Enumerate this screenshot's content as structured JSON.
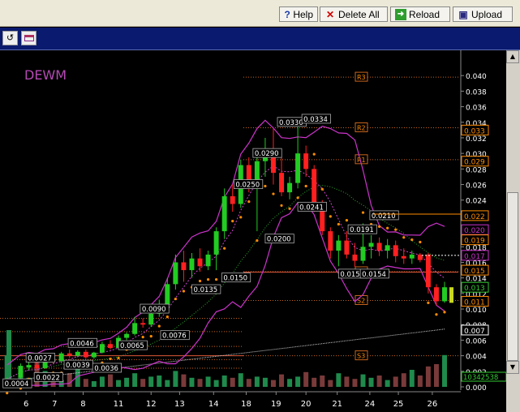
{
  "toolbar": {
    "help_label": "Help",
    "delete_all_label": "Delete All",
    "reload_label": "Reload",
    "upload_label": "Upload"
  },
  "chart_data": {
    "type": "candlestick",
    "title": "DEWM",
    "x_tick_labels": [
      "6",
      "7",
      "8",
      "11",
      "12",
      "13",
      "14",
      "18",
      "19",
      "20",
      "21",
      "24",
      "25",
      "26"
    ],
    "y_axis": {
      "range": [
        0.0,
        0.042
      ],
      "tick_labels": [
        "0.040",
        "0.038",
        "0.036",
        "0.034",
        "0.032",
        "0.030",
        "0.028",
        "0.026",
        "0.024",
        "0.022",
        "0.020",
        "0.018",
        "0.016",
        "0.014",
        "0.012",
        "0.010",
        "0.008",
        "0.006",
        "0.004",
        "0.002",
        "0.000"
      ],
      "highlighted_labels": [
        {
          "text": "0.033",
          "value": 0.033,
          "color": "#ff8c00"
        },
        {
          "text": "0.029",
          "value": 0.029,
          "color": "#ff8c00"
        },
        {
          "text": "0.022",
          "value": 0.022,
          "color": "#ff8c00"
        },
        {
          "text": "0.020",
          "value": 0.0202,
          "color": "#cc33cc"
        },
        {
          "text": "0.019",
          "value": 0.0189,
          "color": "#ff8c00"
        },
        {
          "text": "0.017",
          "value": 0.0169,
          "color": "#cc33cc"
        },
        {
          "text": "0.015",
          "value": 0.015,
          "color": "#ff8c00"
        },
        {
          "text": "0.013",
          "value": 0.0128,
          "color": "#33cc33"
        },
        {
          "text": "0.011",
          "value": 0.011,
          "color": "#ff8c00"
        },
        {
          "text": "0.007",
          "value": 0.0073,
          "color": "#ffffff"
        }
      ],
      "volume_label": "10342538"
    },
    "pivot_levels": [
      {
        "name": "R3",
        "value": 0.0398
      },
      {
        "name": "R2",
        "value": 0.0333
      },
      {
        "name": "R1",
        "value": 0.0292
      },
      {
        "name": "S1",
        "value": 0.0148
      },
      {
        "name": "S2",
        "value": 0.0111
      },
      {
        "name": "S3",
        "value": 0.004
      }
    ],
    "annotations": [
      {
        "text": "0.0004",
        "day": 0.05,
        "value": 0.0004
      },
      {
        "text": "0.0022",
        "day": 1.2,
        "value": 0.0012
      },
      {
        "text": "0.0027",
        "day": 0.9,
        "value": 0.0037
      },
      {
        "text": "0.0039",
        "day": 2.3,
        "value": 0.0028
      },
      {
        "text": "0.0046",
        "day": 2.45,
        "value": 0.0056
      },
      {
        "text": "0.0036",
        "day": 3.35,
        "value": 0.0024
      },
      {
        "text": "0.0065",
        "day": 4.3,
        "value": 0.0053
      },
      {
        "text": "0.0090",
        "day": 5.1,
        "value": 0.01
      },
      {
        "text": "0.0076",
        "day": 5.85,
        "value": 0.0066
      },
      {
        "text": "0.0135",
        "day": 7.0,
        "value": 0.0125
      },
      {
        "text": "0.0150",
        "day": 8.1,
        "value": 0.014
      },
      {
        "text": "0.0250",
        "day": 8.55,
        "value": 0.026
      },
      {
        "text": "0.0200",
        "day": 9.7,
        "value": 0.019
      },
      {
        "text": "0.0290",
        "day": 9.25,
        "value": 0.03
      },
      {
        "text": "0.0330",
        "day": 10.15,
        "value": 0.034
      },
      {
        "text": "0.0334",
        "day": 11.05,
        "value": 0.0344
      },
      {
        "text": "0.0241",
        "day": 10.9,
        "value": 0.0231
      },
      {
        "text": "0.0191",
        "day": 12.75,
        "value": 0.0202
      },
      {
        "text": "0.0155",
        "day": 12.4,
        "value": 0.0145
      },
      {
        "text": "0.0154",
        "day": 13.2,
        "value": 0.0145
      },
      {
        "text": "0.0210",
        "day": 13.55,
        "value": 0.022
      }
    ],
    "candles": [
      {
        "day": 0.2,
        "o": 0.0008,
        "h": 0.0012,
        "l": 0.0004,
        "c": 0.001
      },
      {
        "day": 0.7,
        "o": 0.0012,
        "h": 0.003,
        "l": 0.001,
        "c": 0.0027
      },
      {
        "day": 1.0,
        "o": 0.0025,
        "h": 0.0032,
        "l": 0.0022,
        "c": 0.0028
      },
      {
        "day": 1.3,
        "o": 0.0028,
        "h": 0.0034,
        "l": 0.0022,
        "c": 0.0024
      },
      {
        "day": 1.6,
        "o": 0.0024,
        "h": 0.0038,
        "l": 0.0023,
        "c": 0.0036
      },
      {
        "day": 1.9,
        "o": 0.0036,
        "h": 0.0042,
        "l": 0.003,
        "c": 0.0033
      },
      {
        "day": 2.2,
        "o": 0.0033,
        "h": 0.0045,
        "l": 0.003,
        "c": 0.0043
      },
      {
        "day": 2.5,
        "o": 0.0043,
        "h": 0.0048,
        "l": 0.0037,
        "c": 0.004
      },
      {
        "day": 2.8,
        "o": 0.004,
        "h": 0.0047,
        "l": 0.0038,
        "c": 0.0045
      },
      {
        "day": 3.1,
        "o": 0.0045,
        "h": 0.0048,
        "l": 0.0036,
        "c": 0.0038
      },
      {
        "day": 3.4,
        "o": 0.0038,
        "h": 0.0045,
        "l": 0.0036,
        "c": 0.0044
      },
      {
        "day": 3.7,
        "o": 0.0044,
        "h": 0.0058,
        "l": 0.0043,
        "c": 0.0055
      },
      {
        "day": 4.0,
        "o": 0.0055,
        "h": 0.006,
        "l": 0.0048,
        "c": 0.005
      },
      {
        "day": 4.3,
        "o": 0.005,
        "h": 0.0066,
        "l": 0.0049,
        "c": 0.0063
      },
      {
        "day": 4.6,
        "o": 0.0063,
        "h": 0.007,
        "l": 0.006,
        "c": 0.0068
      },
      {
        "day": 4.9,
        "o": 0.0068,
        "h": 0.009,
        "l": 0.0066,
        "c": 0.0082
      },
      {
        "day": 5.2,
        "o": 0.0082,
        "h": 0.0088,
        "l": 0.0076,
        "c": 0.008
      },
      {
        "day": 5.5,
        "o": 0.008,
        "h": 0.0098,
        "l": 0.0077,
        "c": 0.0094
      },
      {
        "day": 5.8,
        "o": 0.0094,
        "h": 0.0112,
        "l": 0.009,
        "c": 0.0105
      },
      {
        "day": 6.1,
        "o": 0.0105,
        "h": 0.014,
        "l": 0.0102,
        "c": 0.0132
      },
      {
        "day": 6.4,
        "o": 0.0132,
        "h": 0.017,
        "l": 0.0125,
        "c": 0.016
      },
      {
        "day": 6.7,
        "o": 0.016,
        "h": 0.0175,
        "l": 0.0135,
        "c": 0.015
      },
      {
        "day": 7.0,
        "o": 0.015,
        "h": 0.0172,
        "l": 0.014,
        "c": 0.0165
      },
      {
        "day": 7.3,
        "o": 0.0165,
        "h": 0.0178,
        "l": 0.0148,
        "c": 0.0155
      },
      {
        "day": 7.6,
        "o": 0.0155,
        "h": 0.0175,
        "l": 0.015,
        "c": 0.017
      },
      {
        "day": 7.9,
        "o": 0.017,
        "h": 0.0205,
        "l": 0.015,
        "c": 0.02
      },
      {
        "day": 8.2,
        "o": 0.02,
        "h": 0.0255,
        "l": 0.019,
        "c": 0.0245
      },
      {
        "day": 8.5,
        "o": 0.0245,
        "h": 0.026,
        "l": 0.0225,
        "c": 0.0235
      },
      {
        "day": 8.8,
        "o": 0.0235,
        "h": 0.0292,
        "l": 0.023,
        "c": 0.0285
      },
      {
        "day": 9.1,
        "o": 0.0285,
        "h": 0.0295,
        "l": 0.025,
        "c": 0.0265
      },
      {
        "day": 9.4,
        "o": 0.0265,
        "h": 0.03,
        "l": 0.02,
        "c": 0.029
      },
      {
        "day": 9.7,
        "o": 0.029,
        "h": 0.032,
        "l": 0.027,
        "c": 0.0305
      },
      {
        "day": 10.0,
        "o": 0.0305,
        "h": 0.0332,
        "l": 0.026,
        "c": 0.0275
      },
      {
        "day": 10.3,
        "o": 0.0275,
        "h": 0.03,
        "l": 0.0245,
        "c": 0.025
      },
      {
        "day": 10.6,
        "o": 0.025,
        "h": 0.027,
        "l": 0.0241,
        "c": 0.0262
      },
      {
        "day": 10.9,
        "o": 0.0262,
        "h": 0.0334,
        "l": 0.0255,
        "c": 0.03
      },
      {
        "day": 11.2,
        "o": 0.03,
        "h": 0.031,
        "l": 0.027,
        "c": 0.028
      },
      {
        "day": 11.5,
        "o": 0.028,
        "h": 0.0285,
        "l": 0.0225,
        "c": 0.0232
      },
      {
        "day": 11.8,
        "o": 0.0232,
        "h": 0.024,
        "l": 0.0195,
        "c": 0.02
      },
      {
        "day": 12.1,
        "o": 0.02,
        "h": 0.0205,
        "l": 0.0165,
        "c": 0.0175
      },
      {
        "day": 12.4,
        "o": 0.0175,
        "h": 0.0195,
        "l": 0.0155,
        "c": 0.0188
      },
      {
        "day": 12.7,
        "o": 0.0188,
        "h": 0.02,
        "l": 0.0165,
        "c": 0.017
      },
      {
        "day": 13.0,
        "o": 0.017,
        "h": 0.0185,
        "l": 0.0154,
        "c": 0.0162
      },
      {
        "day": 13.3,
        "o": 0.0162,
        "h": 0.021,
        "l": 0.0158,
        "c": 0.018
      },
      {
        "day": 13.6,
        "o": 0.018,
        "h": 0.0195,
        "l": 0.0165,
        "c": 0.0185
      },
      {
        "day": 13.9,
        "o": 0.0185,
        "h": 0.0192,
        "l": 0.0168,
        "c": 0.0175
      },
      {
        "day": 14.2,
        "o": 0.0175,
        "h": 0.019,
        "l": 0.0165,
        "c": 0.0182
      },
      {
        "day": 14.5,
        "o": 0.0182,
        "h": 0.0188,
        "l": 0.016,
        "c": 0.0168
      },
      {
        "day": 14.8,
        "o": 0.0168,
        "h": 0.0178,
        "l": 0.0158,
        "c": 0.0165
      },
      {
        "day": 15.1,
        "o": 0.0165,
        "h": 0.0175,
        "l": 0.0158,
        "c": 0.017
      },
      {
        "day": 15.4,
        "o": 0.017,
        "h": 0.0172,
        "l": 0.016,
        "c": 0.0163
      },
      {
        "day": 15.7,
        "o": 0.017,
        "h": 0.0172,
        "l": 0.012,
        "c": 0.0128
      },
      {
        "day": 16.0,
        "o": 0.0128,
        "h": 0.0132,
        "l": 0.0105,
        "c": 0.011
      },
      {
        "day": 16.3,
        "o": 0.011,
        "h": 0.0135,
        "l": 0.0108,
        "c": 0.0128
      }
    ]
  }
}
